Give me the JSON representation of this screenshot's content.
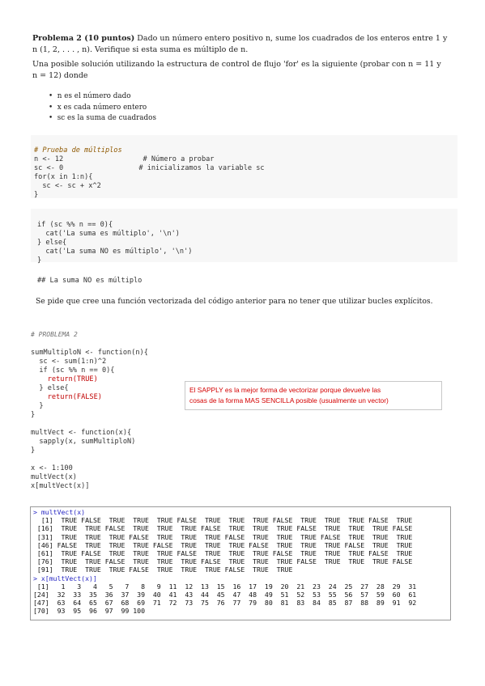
{
  "problem": {
    "title": "Problema 2 (10 puntos)",
    "statement_1": "Dado un número entero positivo n, sume los cuadrados de los enteros entre 1 y",
    "statement_2": "n (1, 2, . . . , n). Verifique si esta suma es múltiplo de n.",
    "intro_1": "Una posible solución utilizando la estructura de control de flujo 'for' es la siguiente (probar con n = 11 y",
    "intro_2": "n = 12) donde",
    "bullets": [
      "n es el número dado",
      "x es cada número entero",
      "sc es la suma de cuadrados"
    ]
  },
  "code_block_1": {
    "lines": [
      "# Prueba de múltiplos",
      "n <- 12                   # Número a probar",
      "sc <- 0                  # inicializamos la variable sc",
      "for(x in 1:n){",
      "  sc <- sc + x^2",
      "}"
    ]
  },
  "code_block_2": {
    "lines": [
      "if (sc %% n == 0){",
      "  cat('La suma es múltiplo', '\\n')",
      "} else{",
      "  cat('La suma NO es múltiplo', '\\n')",
      "}"
    ]
  },
  "output_line": "## La suma NO es múltiplo",
  "task_text": "Se pide que cree una función vectorizada del código anterior para no tener que utilizar bucles explícitos.",
  "script": {
    "comment": "# PROBLEMA 2",
    "lines": [
      "sumMultiploN <- function(n){",
      "  sc <- sum(1:n)^2",
      "  if (sc %% n == 0){",
      "    return(TRUE)",
      "  } else{",
      "    return(FALSE)",
      "  }",
      "}",
      "",
      "multVect <- function(x){",
      "  sapply(x, sumMultiploN)",
      "}",
      "",
      "x <- 1:100",
      "multVect(x)",
      "x[multVect(x)]"
    ]
  },
  "note": {
    "text_1": "El SAPPLY es la mejor forma de vectorizar porque devuelve las",
    "text_2": "cosas de la forma MAS SENCILLA posible (usualmente un vector)",
    "color": "#d40000"
  },
  "console": {
    "lines": [
      "> multVect(x)",
      "  [1]  TRUE FALSE  TRUE  TRUE  TRUE FALSE  TRUE  TRUE  TRUE FALSE  TRUE  TRUE  TRUE FALSE  TRUE",
      " [16]  TRUE  TRUE FALSE  TRUE  TRUE  TRUE FALSE  TRUE  TRUE  TRUE FALSE  TRUE  TRUE  TRUE FALSE",
      " [31]  TRUE  TRUE  TRUE FALSE  TRUE  TRUE  TRUE FALSE  TRUE  TRUE  TRUE FALSE  TRUE  TRUE  TRUE",
      " [46] FALSE  TRUE  TRUE  TRUE FALSE  TRUE  TRUE  TRUE FALSE  TRUE  TRUE  TRUE FALSE  TRUE  TRUE",
      " [61]  TRUE FALSE  TRUE  TRUE  TRUE FALSE  TRUE  TRUE  TRUE FALSE  TRUE  TRUE  TRUE FALSE  TRUE",
      " [76]  TRUE  TRUE FALSE  TRUE  TRUE  TRUE FALSE  TRUE  TRUE  TRUE FALSE  TRUE  TRUE  TRUE FALSE",
      " [91]  TRUE  TRUE  TRUE FALSE  TRUE  TRUE  TRUE FALSE  TRUE  TRUE",
      "> x[multVect(x)]",
      " [1]   1   3   4   5   7   8   9  11  12  13  15  16  17  19  20  21  23  24  25  27  28  29  31",
      "[24]  32  33  35  36  37  39  40  41  43  44  45  47  48  49  51  52  53  55  56  57  59  60  61",
      "[47]  63  64  65  67  68  69  71  72  73  75  76  77  79  80  81  83  84  85  87  88  89  91  92",
      "[70]  93  95  96  97  99 100"
    ]
  }
}
